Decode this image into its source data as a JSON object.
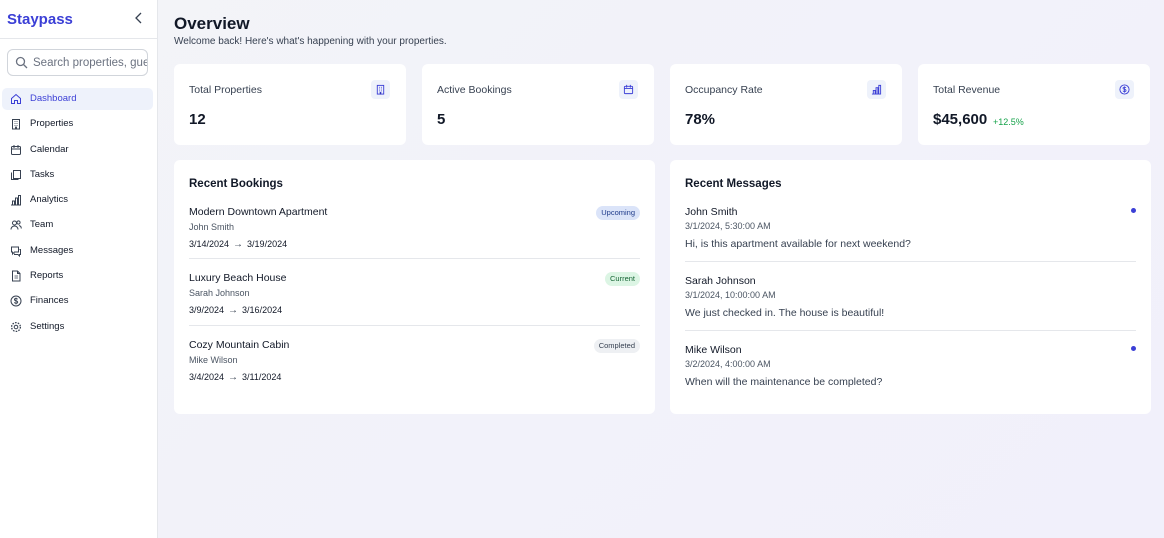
{
  "brand": "Staypass",
  "search": {
    "placeholder": "Search properties, guests..."
  },
  "nav": [
    {
      "label": "Dashboard",
      "icon": "home-icon",
      "active": true
    },
    {
      "label": "Properties",
      "icon": "building-icon"
    },
    {
      "label": "Calendar",
      "icon": "calendar-icon"
    },
    {
      "label": "Tasks",
      "icon": "clipboard-icon"
    },
    {
      "label": "Analytics",
      "icon": "bar-chart-icon"
    },
    {
      "label": "Team",
      "icon": "users-icon"
    },
    {
      "label": "Messages",
      "icon": "message-icon"
    },
    {
      "label": "Reports",
      "icon": "file-icon"
    },
    {
      "label": "Finances",
      "icon": "dollar-icon"
    },
    {
      "label": "Settings",
      "icon": "gear-icon"
    }
  ],
  "header": {
    "title": "Overview",
    "subtitle": "Welcome back! Here's what's happening with your properties."
  },
  "stats": [
    {
      "label": "Total Properties",
      "value": "12",
      "icon": "building-icon"
    },
    {
      "label": "Active Bookings",
      "value": "5",
      "icon": "calendar-icon"
    },
    {
      "label": "Occupancy Rate",
      "value": "78%",
      "icon": "bar-chart-icon"
    },
    {
      "label": "Total Revenue",
      "value": "$45,600",
      "trend": "+12.5%",
      "icon": "dollar-icon"
    }
  ],
  "bookings": {
    "title": "Recent Bookings",
    "items": [
      {
        "property": "Modern Downtown Apartment",
        "guest": "John Smith",
        "checkin": "3/14/2024",
        "checkout": "3/19/2024",
        "status": "Upcoming"
      },
      {
        "property": "Luxury Beach House",
        "guest": "Sarah Johnson",
        "checkin": "3/9/2024",
        "checkout": "3/16/2024",
        "status": "Current"
      },
      {
        "property": "Cozy Mountain Cabin",
        "guest": "Mike Wilson",
        "checkin": "3/4/2024",
        "checkout": "3/11/2024",
        "status": "Completed"
      }
    ]
  },
  "messages": {
    "title": "Recent Messages",
    "items": [
      {
        "from": "John Smith",
        "time": "3/1/2024, 5:30:00 AM",
        "text": "Hi, is this apartment available for next weekend?",
        "unread": true
      },
      {
        "from": "Sarah Johnson",
        "time": "3/1/2024, 10:00:00 AM",
        "text": "We just checked in. The house is beautiful!",
        "unread": false
      },
      {
        "from": "Mike Wilson",
        "time": "3/2/2024, 4:00:00 AM",
        "text": "When will the maintenance be completed?",
        "unread": true
      }
    ]
  },
  "colors": {
    "accent": "#3b3fd6",
    "trend": "#16a34a"
  }
}
